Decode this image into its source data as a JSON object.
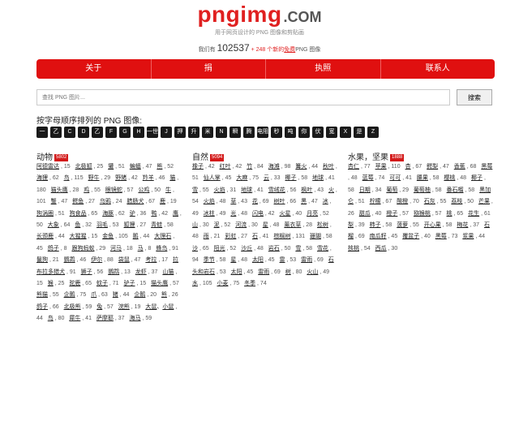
{
  "logo": {
    "main": "pngimg",
    "suffix": ".COM"
  },
  "tagline": "用于网页设计的 PNG 图像和剪贴画",
  "stats": {
    "prefix": "我们有",
    "total": "102537",
    "plus": "+ 248",
    "mid": "个新的",
    "link": "免费",
    "suffix": "PNG 图像"
  },
  "nav": [
    "关于",
    "捐",
    "执照",
    "联系人"
  ],
  "search": {
    "placeholder": "查找 PNG 图片...",
    "button": "搜索"
  },
  "section_title": "按字母顺序排列的 PNG 图像:",
  "letters": [
    "一",
    "乙",
    "C",
    "D",
    "乙",
    "F",
    "G",
    "H",
    "一世",
    "J",
    "押",
    "升",
    "米",
    "N",
    "瞬",
    "腾",
    "电阻",
    "秒",
    "吨",
    "你",
    "伏",
    "宽",
    "X",
    "是",
    "Z"
  ],
  "columns": [
    {
      "name": "动物",
      "count": "5802",
      "items": [
        [
          "阿德雷达",
          "15"
        ],
        [
          "北极狐",
          "25"
        ],
        [
          "獾",
          "51"
        ],
        [
          "蝙蝠",
          "47"
        ],
        [
          "熊",
          "52"
        ],
        [
          "海狸",
          "62"
        ],
        [
          "鸟",
          "115"
        ],
        [
          "野牛",
          "29"
        ],
        [
          "野猪",
          "42"
        ],
        [
          "羚羊",
          "46"
        ],
        [
          "猫",
          "180"
        ],
        [
          "猫头鹰",
          "28"
        ],
        [
          "鸡",
          "55"
        ],
        [
          "眼镜蛇",
          "57"
        ],
        [
          "公鸡",
          "50"
        ],
        [
          "牛",
          "101"
        ],
        [
          "蟹",
          "47"
        ],
        [
          "鳄鱼",
          "27"
        ],
        [
          "乌鸦",
          "24"
        ],
        [
          "腊肠犬",
          "67"
        ],
        [
          "鹿",
          "19"
        ],
        [
          "狗涡圈",
          "51"
        ],
        [
          "狗食品",
          "65"
        ],
        [
          "海豚",
          "62"
        ],
        [
          "驴",
          "36"
        ],
        [
          "鸭",
          "42"
        ],
        [
          "鹰",
          "50"
        ],
        [
          "大象",
          "64"
        ],
        [
          "鱼",
          "32"
        ],
        [
          "羽毛",
          "53"
        ],
        [
          "狐狸",
          "27"
        ],
        [
          "青蛙",
          "58"
        ],
        [
          "长颈鹿",
          "44"
        ],
        [
          "大猩猩",
          "15"
        ],
        [
          "金鱼",
          "105"
        ],
        [
          "鹅",
          "44"
        ],
        [
          "大理石",
          "45"
        ],
        [
          "鸽子",
          "8"
        ],
        [
          "跟狗蚂蚁",
          "29"
        ],
        [
          "河马",
          "18"
        ],
        [
          "马",
          "8"
        ],
        [
          "蜂鸟",
          "91"
        ],
        [
          "鬣狗",
          "21"
        ],
        [
          "鹦鹉",
          "46"
        ],
        [
          "伊尔",
          "88"
        ],
        [
          "袋鼠",
          "47"
        ],
        [
          "考拉",
          "17"
        ],
        [
          "拉布拉多猎犬",
          "91"
        ],
        [
          "狮子",
          "56"
        ],
        [
          "鹦鹉",
          "13"
        ],
        [
          "龙虾",
          "37"
        ],
        [
          "山猫",
          "15"
        ],
        [
          "猴",
          "25"
        ],
        [
          "驼鹿",
          "65"
        ],
        [
          "蚊子",
          "71"
        ],
        [
          "驴子",
          "15"
        ],
        [
          "猫头鹰",
          "57"
        ],
        [
          "熊猫",
          "55"
        ],
        [
          "企鹅",
          "75"
        ],
        [
          "爪",
          "63"
        ],
        [
          "猪",
          "44"
        ],
        [
          "企鹅",
          "20"
        ],
        [
          "熊",
          "26"
        ],
        [
          "鸽子",
          "66"
        ],
        [
          "北极熊",
          "59"
        ],
        [
          "兔",
          "57"
        ],
        [
          "浣熊",
          "19"
        ],
        [
          "大鼠",
          "小鼠",
          "44"
        ],
        [
          "鸟",
          "80"
        ],
        [
          "犀牛",
          "41"
        ],
        [
          "萨摩耶",
          "37"
        ],
        [
          "海马",
          "59"
        ]
      ]
    },
    {
      "name": "自然",
      "count": "5094",
      "items": [
        [
          "橡子",
          "42"
        ],
        [
          "红叶",
          "42"
        ],
        [
          "竹",
          "84"
        ],
        [
          "海滩",
          "98"
        ],
        [
          "篝火",
          "44"
        ],
        [
          "秋叶",
          "51"
        ],
        [
          "仙人掌",
          "45"
        ],
        [
          "大麻",
          "75"
        ],
        [
          "云",
          "33"
        ],
        [
          "椰子",
          "58"
        ],
        [
          "地球",
          "41"
        ],
        [
          "雪",
          "55"
        ],
        [
          "火焰",
          "31"
        ],
        [
          "地球",
          "41"
        ],
        [
          "雪绒花",
          "56"
        ],
        [
          "枫叶",
          "43"
        ],
        [
          "火",
          "54"
        ],
        [
          "火焰",
          "48"
        ],
        [
          "草",
          "43"
        ],
        [
          "花",
          "69"
        ],
        [
          "树叶",
          "66"
        ],
        [
          "黑",
          "47"
        ],
        [
          "冰",
          "49"
        ],
        [
          "冰柱",
          "49"
        ],
        [
          "光",
          "48"
        ],
        [
          "闪电",
          "42"
        ],
        [
          "火星",
          "40"
        ],
        [
          "月亮",
          "52"
        ],
        [
          "山",
          "30"
        ],
        [
          "泥",
          "52"
        ],
        [
          "河流",
          "30"
        ],
        [
          "星",
          "48"
        ],
        [
          "薰衣草",
          "28"
        ],
        [
          "松树",
          "48"
        ],
        [
          "雨",
          "21"
        ],
        [
          "彩虹",
          "27"
        ],
        [
          "石",
          "41"
        ],
        [
          "棕榈树",
          "131"
        ],
        [
          "珊瑚",
          "58"
        ],
        [
          "沙",
          "65"
        ],
        [
          "阳光",
          "52"
        ],
        [
          "沙丘",
          "48"
        ],
        [
          "岩石",
          "50"
        ],
        [
          "雪",
          "58"
        ],
        [
          "雪花",
          "94"
        ],
        [
          "季节",
          "58"
        ],
        [
          "星",
          "48"
        ],
        [
          "太阳",
          "45"
        ],
        [
          "雷",
          "53"
        ],
        [
          "雷雨",
          "69"
        ],
        [
          "石头和岩石",
          "53"
        ],
        [
          "太阳",
          "45"
        ],
        [
          "雷雨",
          "69"
        ],
        [
          "树",
          "80"
        ],
        [
          "火山",
          "49"
        ],
        [
          "水",
          "105"
        ],
        [
          "小麦",
          "75"
        ],
        [
          "冬季",
          "74"
        ]
      ]
    },
    {
      "name": "水果，坚果",
      "count": "1888",
      "items": [
        [
          "杏仁",
          "77"
        ],
        [
          "苹果",
          "110"
        ],
        [
          "杏",
          "67"
        ],
        [
          "鳄梨",
          "47"
        ],
        [
          "香蕉",
          "68"
        ],
        [
          "黑莓",
          "48"
        ],
        [
          "蓝莓",
          "74"
        ],
        [
          "可可",
          "41"
        ],
        [
          "腰果",
          "58"
        ],
        [
          "樱桃",
          "48"
        ],
        [
          "椰子",
          "58"
        ],
        [
          "日期",
          "34"
        ],
        [
          "葡萄",
          "29"
        ],
        [
          "葡萄柚",
          "58"
        ],
        [
          "番石榴",
          "58"
        ],
        [
          "黑加仑",
          "51"
        ],
        [
          "柠檬",
          "67"
        ],
        [
          "酸橙",
          "70"
        ],
        [
          "石灰",
          "55"
        ],
        [
          "荔枝",
          "50"
        ],
        [
          "芒果",
          "26"
        ],
        [
          "甜瓜",
          "40"
        ],
        [
          "橙子",
          "57"
        ],
        [
          "猕猴桃",
          "57"
        ],
        [
          "桃",
          "65"
        ],
        [
          "花生",
          "61"
        ],
        [
          "梨",
          "39"
        ],
        [
          "柿子",
          "58"
        ],
        [
          "菠萝",
          "55"
        ],
        [
          "开心果",
          "58"
        ],
        [
          "梅花",
          "37"
        ],
        [
          "石榴",
          "69"
        ],
        [
          "南瓜籽",
          "45"
        ],
        [
          "覆盆子",
          "40"
        ],
        [
          "黑莓",
          "73"
        ],
        [
          "浆果",
          "44"
        ],
        [
          "核桃",
          "54"
        ],
        [
          "西瓜",
          "30"
        ]
      ]
    }
  ]
}
